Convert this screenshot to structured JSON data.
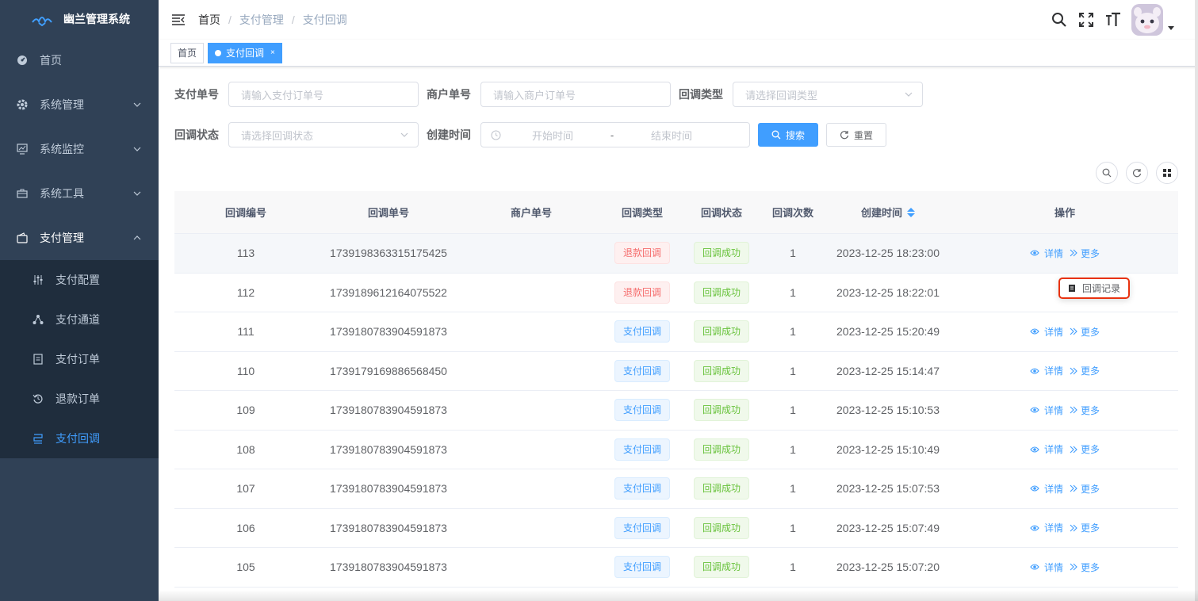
{
  "app": {
    "title": "幽兰管理系统"
  },
  "sidebar": {
    "items": [
      {
        "label": "首页",
        "icon": "dashboard-icon"
      },
      {
        "label": "系统管理",
        "icon": "gear-icon"
      },
      {
        "label": "系统监控",
        "icon": "monitor-icon"
      },
      {
        "label": "系统工具",
        "icon": "toolbox-icon"
      },
      {
        "label": "支付管理",
        "icon": "wallet-icon"
      }
    ],
    "sub": [
      {
        "label": "支付配置",
        "icon": "sliders-icon"
      },
      {
        "label": "支付通道",
        "icon": "channel-icon"
      },
      {
        "label": "支付订单",
        "icon": "order-icon"
      },
      {
        "label": "退款订单",
        "icon": "refund-icon"
      },
      {
        "label": "支付回调",
        "icon": "callback-icon"
      }
    ]
  },
  "breadcrumb": [
    "首页",
    "支付管理",
    "支付回调"
  ],
  "tags": {
    "home": "首页",
    "active": "支付回调",
    "close": "×"
  },
  "form": {
    "pay_no_label": "支付单号",
    "pay_no_placeholder": "请输入支付订单号",
    "merchant_no_label": "商户单号",
    "merchant_no_placeholder": "请输入商户订单号",
    "callback_type_label": "回调类型",
    "callback_type_placeholder": "请选择回调类型",
    "callback_status_label": "回调状态",
    "callback_status_placeholder": "请选择回调状态",
    "create_time_label": "创建时间",
    "start_placeholder": "开始时间",
    "range_sep": "-",
    "end_placeholder": "结束时间",
    "search_btn": "搜索",
    "reset_btn": "重置"
  },
  "table": {
    "columns": [
      "回调编号",
      "回调单号",
      "商户单号",
      "回调类型",
      "回调状态",
      "回调次数",
      "创建时间",
      "操作"
    ],
    "rows": [
      {
        "id": "113",
        "no": "1739198363315175425",
        "merchant": "",
        "type": "退款回调",
        "type_kind": "danger",
        "status": "回调成功",
        "count": "1",
        "time": "2023-12-25 18:23:00"
      },
      {
        "id": "112",
        "no": "1739189612164075522",
        "merchant": "",
        "type": "退款回调",
        "type_kind": "danger",
        "status": "回调成功",
        "count": "1",
        "time": "2023-12-25 18:22:01"
      },
      {
        "id": "111",
        "no": "1739180783904591873",
        "merchant": "",
        "type": "支付回调",
        "type_kind": "primary",
        "status": "回调成功",
        "count": "1",
        "time": "2023-12-25 15:20:49"
      },
      {
        "id": "110",
        "no": "1739179169886568450",
        "merchant": "",
        "type": "支付回调",
        "type_kind": "primary",
        "status": "回调成功",
        "count": "1",
        "time": "2023-12-25 15:14:47"
      },
      {
        "id": "109",
        "no": "1739180783904591873",
        "merchant": "",
        "type": "支付回调",
        "type_kind": "primary",
        "status": "回调成功",
        "count": "1",
        "time": "2023-12-25 15:10:53"
      },
      {
        "id": "108",
        "no": "1739180783904591873",
        "merchant": "",
        "type": "支付回调",
        "type_kind": "primary",
        "status": "回调成功",
        "count": "1",
        "time": "2023-12-25 15:10:49"
      },
      {
        "id": "107",
        "no": "1739180783904591873",
        "merchant": "",
        "type": "支付回调",
        "type_kind": "primary",
        "status": "回调成功",
        "count": "1",
        "time": "2023-12-25 15:07:53"
      },
      {
        "id": "106",
        "no": "1739180783904591873",
        "merchant": "",
        "type": "支付回调",
        "type_kind": "primary",
        "status": "回调成功",
        "count": "1",
        "time": "2023-12-25 15:07:49"
      },
      {
        "id": "105",
        "no": "1739180783904591873",
        "merchant": "",
        "type": "支付回调",
        "type_kind": "primary",
        "status": "回调成功",
        "count": "1",
        "time": "2023-12-25 15:07:20"
      }
    ],
    "detail_label": "详情",
    "more_label": "更多"
  },
  "dropdown": {
    "label": "回调记录"
  },
  "colors": {
    "sidebar_bg": "#304156",
    "submenu_bg": "#1f2d3d",
    "accent": "#409eff",
    "danger": "#f56c6c",
    "success": "#67c23a"
  }
}
